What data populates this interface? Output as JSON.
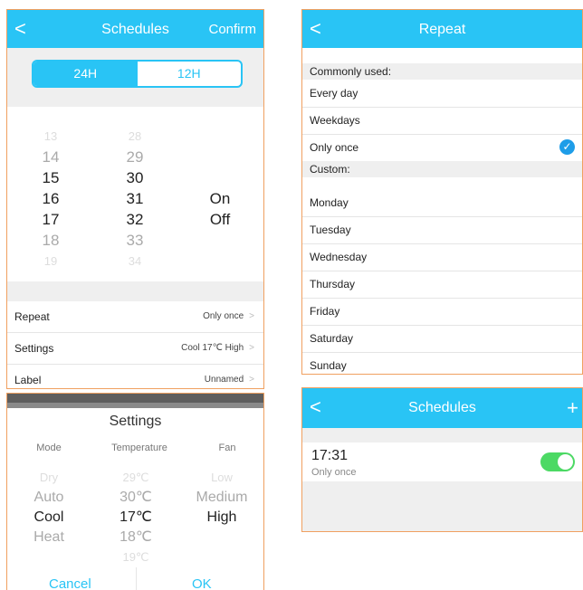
{
  "schedule_time": {
    "header": {
      "title": "Schedules",
      "confirm": "Confirm"
    },
    "toggle": {
      "h24": "24H",
      "h12": "12H"
    },
    "hours": [
      "13",
      "14",
      "15",
      "16",
      "17",
      "18",
      "19"
    ],
    "minutes": [
      "28",
      "29",
      "30",
      "31",
      "32",
      "33",
      "34"
    ],
    "onoff": [
      "On",
      "Off"
    ],
    "rows": [
      {
        "label": "Repeat",
        "value": "Only once"
      },
      {
        "label": "Settings",
        "value": "Cool 17℃ High"
      },
      {
        "label": "Label",
        "value": "Unnamed"
      }
    ]
  },
  "repeat": {
    "header": {
      "title": "Repeat"
    },
    "common_title": "Commonly used:",
    "common": [
      "Every day",
      "Weekdays",
      "Only once"
    ],
    "selected": "Only once",
    "custom_title": "Custom:",
    "custom": [
      "Monday",
      "Tuesday",
      "Wednesday",
      "Thursday",
      "Friday",
      "Saturday",
      "Sunday"
    ]
  },
  "settings_dialog": {
    "title": "Settings",
    "columns": [
      "Mode",
      "Temperature",
      "Fan"
    ],
    "mode": [
      "Dry",
      "Auto",
      "Cool",
      "Heat"
    ],
    "temperature": [
      "29℃",
      "30℃",
      "17℃",
      "18℃",
      "19℃"
    ],
    "fan": [
      "Low",
      "Medium",
      "High"
    ],
    "cancel": "Cancel",
    "ok": "OK"
  },
  "schedule_list": {
    "header": {
      "title": "Schedules",
      "add": "+"
    },
    "item": {
      "time": "17:31",
      "repeat": "Only once",
      "enabled": true
    }
  },
  "colors": {
    "accent": "#29c4f5",
    "toggle_on": "#4cd964",
    "check": "#1e9de8"
  },
  "icons": {
    "back": "<",
    "chevron": ">",
    "check": "✓"
  }
}
